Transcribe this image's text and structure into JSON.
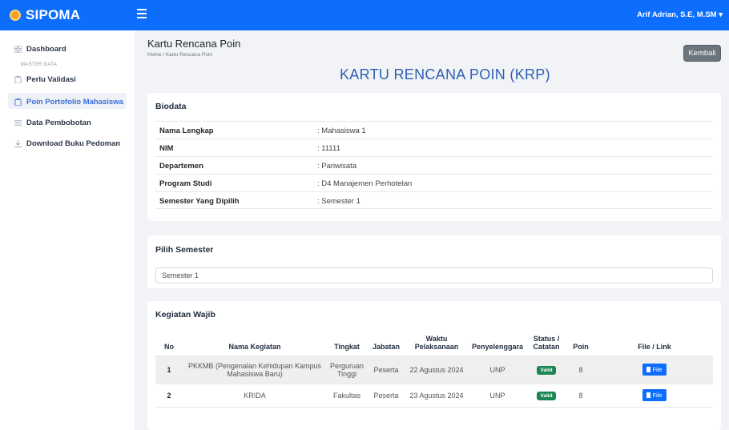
{
  "app": {
    "name": "SIPOMA",
    "user": "Arif Adrian, S.E, M.SM ▾"
  },
  "sidebar": {
    "dashboard": "Dashboard",
    "section": "MASTER DATA",
    "items": [
      "Perlu Validasi",
      "Poin Portofolio Mahasiswa",
      "Data Pembobotan",
      "Download Buku Pedoman"
    ],
    "active_index": 1
  },
  "page": {
    "title": "Kartu Rencana Poin",
    "breadcrumb": "Home / Kartu Rencana Poin",
    "back_label": "Kembali",
    "heading": "KARTU RENCANA POIN (KRP)"
  },
  "biodata": {
    "title": "Biodata",
    "rows": [
      {
        "label": "Nama Lengkap",
        "value": ": Mahasiswa 1"
      },
      {
        "label": "NIM",
        "value": ": 11111"
      },
      {
        "label": "Departemen",
        "value": ": Pariwisata"
      },
      {
        "label": "Program Studi",
        "value": ": D4 Manajemen Perhotelan"
      },
      {
        "label": "Semester Yang Dipilih",
        "value": ": Semester 1"
      }
    ]
  },
  "semester": {
    "title": "Pilih Semester",
    "value": "Semester 1"
  },
  "kegiatan": {
    "title": "Kegiatan Wajib",
    "headers": [
      "No",
      "Nama Kegiatan",
      "Tingkat",
      "Jabatan",
      "Waktu Pelaksanaan",
      "Penyelenggara",
      "Status / Catatan",
      "Poin",
      "File / Link"
    ],
    "rows": [
      {
        "no": "1",
        "nama": "PKKMB (Pengenalan Kehidupan Kampus Mahasiswa Baru)",
        "tingkat": "Perguruan Tinggi",
        "jabatan": "Peserta",
        "waktu": "22 Agustus 2024",
        "penyelenggara": "UNP",
        "status": "Valid",
        "poin": "8",
        "file": "File"
      },
      {
        "no": "2",
        "nama": "KRIDA",
        "tingkat": "Fakultas",
        "jabatan": "Peserta",
        "waktu": "23 Agustus 2024",
        "penyelenggara": "UNP",
        "status": "Valid",
        "poin": "8",
        "file": "File"
      }
    ]
  },
  "colors": {
    "primary": "#0d6efd",
    "success": "#198754",
    "secondary": "#6c757d",
    "heading": "#2f5fb3"
  },
  "icons": [
    "menu-icon",
    "grid-icon",
    "clipboard-icon",
    "list-icon",
    "download-icon",
    "document-icon"
  ]
}
